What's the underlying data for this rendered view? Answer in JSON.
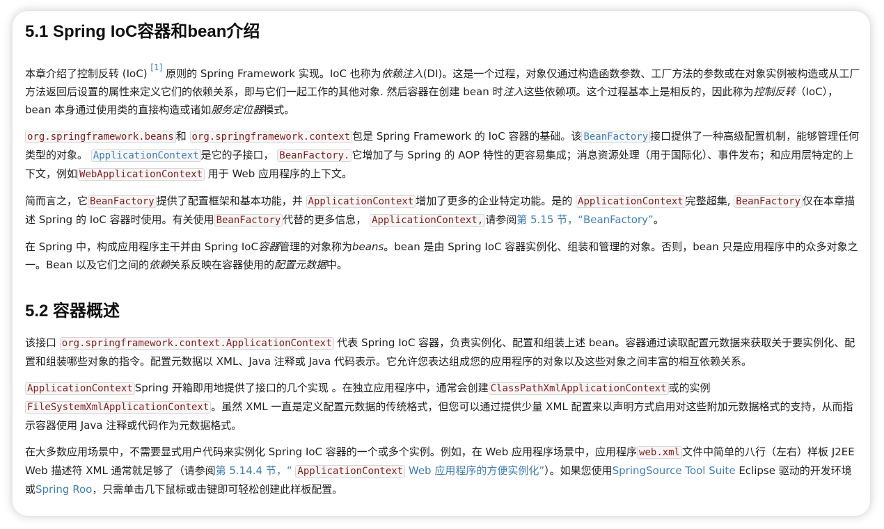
{
  "s1": {
    "title": "5.1 Spring IoC容器和bean介绍",
    "p1": {
      "a": "本章介绍了控制反转 (IoC) ",
      "footnote": "[1]",
      "b": " 原则的 Spring Framework 实现。IoC 也称为",
      "em1": "依赖注入",
      "c": "(DI)。这是一个过程，对象仅通过构造函数参数、工厂方法的参数或在对象实例被构造或从工厂方法返回后设置的属性来定义它们的依赖关系，即与它们一起工作的其他对象. 然后容器在创建 bean 时",
      "em2": "注入",
      "d": "这些依赖项。这个过程基本上是相反的，因此称为",
      "em3": "控制反转",
      "e": "（IoC），bean 本身通过使用类的直接构造或诸如",
      "em4": "服务定位器",
      "f": "模式。"
    },
    "p2": {
      "c1": "org.springframework.beans",
      "t1": "和 ",
      "c2": "org.springframework.context",
      "t2": "包是 Spring Framework 的 IoC 容器的基础。该",
      "c3": "BeanFactory",
      "t3": "接口提供了一种高级配置机制，能够管理任何类型的对象。 ",
      "c4": "ApplicationContext",
      "t4": "是它的子接口， ",
      "c5": "BeanFactory.",
      "t5": "它增加了与 Spring 的 AOP 特性的更容易集成；消息资源处理（用于国际化）、事件发布；和应用层特定的上下文，例如",
      "c6": "WebApplicationContext",
      "t6": " 用于 Web 应用程序的上下文。"
    },
    "p3": {
      "t0": "简而言之，它",
      "c1": "BeanFactory",
      "t1": "提供了配置框架和基本功能，并 ",
      "c2": "ApplicationContext",
      "t2": "增加了更多的企业特定功能。是的 ",
      "c3": "ApplicationContext",
      "t3": "完整超集, ",
      "c4": "BeanFactory",
      "t4": "仅在本章描述 Spring 的 IoC 容器时使用。有关使用",
      "c5": "BeanFactory",
      "t5": "代替的更多信息， ",
      "c6": "ApplicationContext,",
      "t6": "请参阅",
      "link": "第 5.15 节，“BeanFactory”",
      "t7": "。"
    },
    "p4": {
      "a": "在 Spring 中，构成应用程序主干并由 Spring IoC",
      "em1": "容器",
      "b": "管理的对象称为",
      "em2": "beans",
      "c": "。bean 是由 Spring IoC 容器实例化、组装和管理的对象。否则，bean 只是应用程序中的众多对象之一。Bean 以及它们之间的",
      "em3": "依赖",
      "d": "关系反映在容器使用的",
      "em4": "配置元数据",
      "e": "中。"
    }
  },
  "s2": {
    "title": "5.2 容器概述",
    "p1": {
      "t0": "该接口 ",
      "c1": "org.springframework.context.ApplicationContext",
      "t1": " 代表 Spring IoC 容器，负责实例化、配置和组装上述 bean。容器通过读取配置元数据来获取关于要实例化、配置和组装哪些对象的指令。配置元数据以 XML、Java 注释或 Java 代码表示。它允许您表达组成您的应用程序的对象以及这些对象之间丰富的相互依赖关系。"
    },
    "p2": {
      "c1": "ApplicationContext",
      "t1": "Spring 开箱即用地提供了接口的几个实现 。在独立应用程序中，通常会创建",
      "c2": "ClassPathXmlApplicationContext",
      "t2": "或的实例",
      "c3": "FileSystemXmlApplicationContext",
      "t3": "。虽然 XML 一直是定义配置元数据的传统格式，但您可以通过提供少量 XML 配置来以声明方式启用对这些附加元数据格式的支持，从而指示容器使用 Java 注释或代码作为元数据格式。"
    },
    "p3": {
      "t0": "在大多数应用场景中，不需要显式用户代码来实例化 Spring IoC 容器的一个或多个实例。例如，在 Web 应用程序场景中，应用程序",
      "c1": "web.xml",
      "t1": "文件中简单的八行（左右）样板 J2EE Web 描述符 XML 通常就足够了（请参阅",
      "link1a": "第 5.14.4 节，“ ",
      "c2": "ApplicationContext",
      "link1b": " Web 应用程序的方便实例化”",
      "t2": "）。如果您使用",
      "link2": "SpringSource Tool Suite",
      "t3": " Eclipse 驱动的开发环境或",
      "link3": "Spring Roo",
      "t4": "，只需单击几下鼠标或击键即可轻松创建此样板配置。"
    }
  }
}
